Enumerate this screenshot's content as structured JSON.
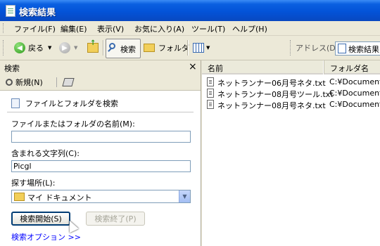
{
  "window": {
    "title": "検索結果"
  },
  "menu": [
    "ファイル(F)",
    "編集(E)",
    "表示(V)",
    "お気に入り(A)",
    "ツール(T)",
    "ヘルプ(H)"
  ],
  "toolbar": {
    "back_label": "戻る",
    "search_label": "検索",
    "folders_label": "フォルダ",
    "address_label": "アドレス(D)",
    "address_value": "検索結果"
  },
  "search_pane": {
    "title": "検索",
    "close_glyph": "×",
    "new_label": "新規(N)",
    "heading": "ファイルとフォルダを検索",
    "name_label": "ファイルまたはフォルダの名前(M):",
    "name_value": "",
    "contains_label": "含まれる文字列(C):",
    "contains_value": "Picgl",
    "lookin_label": "探す場所(L):",
    "lookin_value": "マイ ドキュメント",
    "search_button": "検索開始(S)",
    "stop_button": "検索終了(P)",
    "options_link": "検索オプション >>"
  },
  "results": {
    "columns": [
      "名前",
      "フォルダ名"
    ],
    "rows": [
      {
        "name": "ネットランナー06月号ネタ.txt",
        "folder": "C:¥Documents"
      },
      {
        "name": "ネットランナー08月号ツール.txt",
        "folder": "C:¥Documents"
      },
      {
        "name": "ネットランナー08月号ネタ.txt",
        "folder": "C:¥Documents"
      }
    ]
  },
  "colors": {
    "title_bar": "#0353d8",
    "chrome": "#ece9d8",
    "field_border": "#7f9db9",
    "link": "#0000ff"
  }
}
